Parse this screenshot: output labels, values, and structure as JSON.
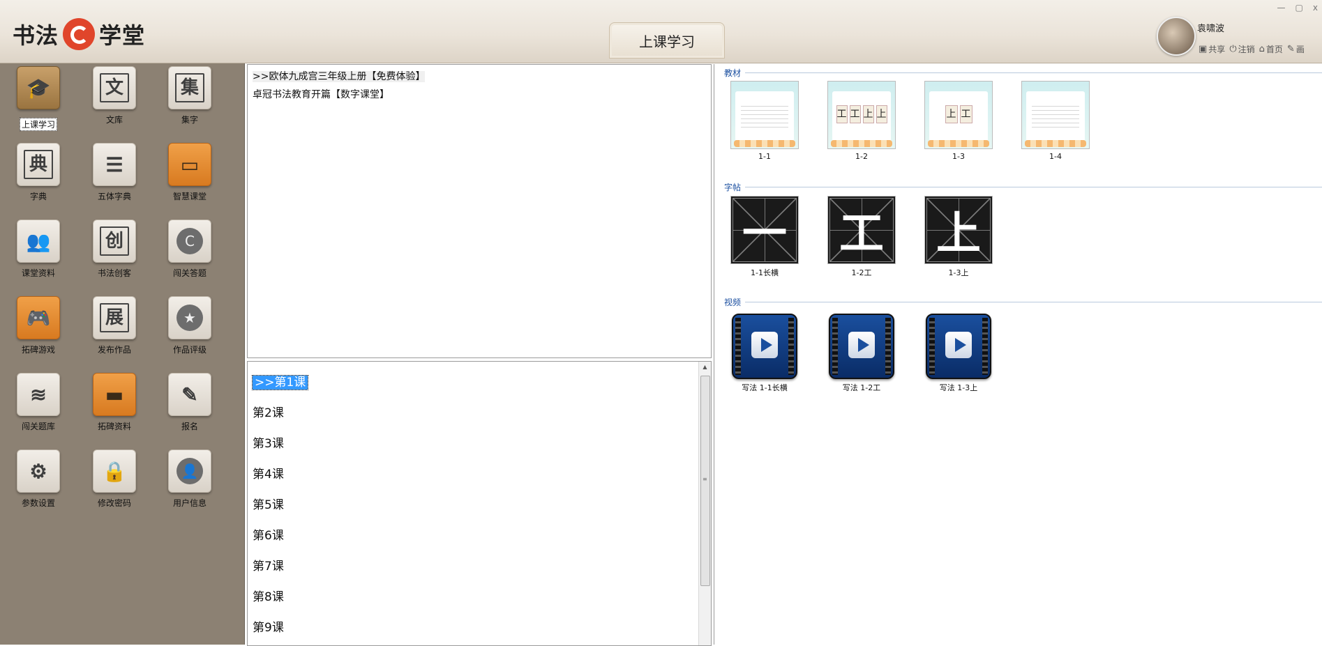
{
  "header": {
    "logo_left": "书法",
    "logo_right": "学堂",
    "title": "上课学习",
    "window_controls": [
      "—",
      "▢",
      "x"
    ],
    "user": {
      "name": "袁啸波",
      "links": [
        {
          "icon": "image-icon",
          "glyph": "▣",
          "label": "共享"
        },
        {
          "icon": "power-icon",
          "glyph": "⏻",
          "label": "注销"
        },
        {
          "icon": "home-icon",
          "glyph": "⌂",
          "label": "首页"
        },
        {
          "icon": "pencil-icon",
          "glyph": "✎",
          "label": "画"
        }
      ]
    }
  },
  "sidebar": {
    "items": [
      {
        "label": "上课学习",
        "icon": "graduation-cap-icon",
        "glyph": "🎓",
        "style": "selected"
      },
      {
        "label": "文库",
        "icon": "wen-char-icon",
        "glyph": "文",
        "style": "normal"
      },
      {
        "label": "集字",
        "icon": "ji-char-icon",
        "glyph": "集",
        "style": "normal"
      },
      {
        "label": "字典",
        "icon": "dian-char-icon",
        "glyph": "典",
        "style": "normal"
      },
      {
        "label": "五体字典",
        "icon": "list-book-icon",
        "glyph": "☰",
        "style": "normal"
      },
      {
        "label": "智慧课堂",
        "icon": "presentation-board-icon",
        "glyph": "▭",
        "style": "orange"
      },
      {
        "label": "课堂资料",
        "icon": "users-icon",
        "glyph": "👥",
        "style": "normal"
      },
      {
        "label": "书法创客",
        "icon": "chuang-char-icon",
        "glyph": "创",
        "style": "normal"
      },
      {
        "label": "闯关答题",
        "icon": "c-circle-icon",
        "glyph": "C",
        "style": "normal"
      },
      {
        "label": "拓碑游戏",
        "icon": "gamepad-icon",
        "glyph": "🎮",
        "style": "orange"
      },
      {
        "label": "发布作品",
        "icon": "zhan-char-icon",
        "glyph": "展",
        "style": "normal"
      },
      {
        "label": "作品评级",
        "icon": "star-circle-icon",
        "glyph": "★",
        "style": "normal"
      },
      {
        "label": "闯关题库",
        "icon": "layers-icon",
        "glyph": "≋",
        "style": "normal"
      },
      {
        "label": "拓碑资料",
        "icon": "book-icon",
        "glyph": "▬",
        "style": "orange"
      },
      {
        "label": "报名",
        "icon": "edit-icon",
        "glyph": "✎",
        "style": "normal"
      },
      {
        "label": "参数设置",
        "icon": "gears-icon",
        "glyph": "⚙",
        "style": "normal"
      },
      {
        "label": "修改密码",
        "icon": "lock-icon",
        "glyph": "🔒",
        "style": "normal"
      },
      {
        "label": "用户信息",
        "icon": "user-circle-icon",
        "glyph": "👤",
        "style": "normal"
      }
    ]
  },
  "courses": [
    ">>欧体九成宫三年级上册【免费体验】",
    "卓冠书法教育开篇【数字课堂】"
  ],
  "lessons": [
    ">>第1课",
    "第2课",
    "第3课",
    "第4课",
    "第5课",
    "第6课",
    "第7课",
    "第8课",
    "第9课"
  ],
  "resources": {
    "textbook": {
      "title": "教材",
      "items": [
        {
          "label": "1-1",
          "chars": ""
        },
        {
          "label": "1-2",
          "chars": "工工上上"
        },
        {
          "label": "1-3",
          "chars": "上工"
        },
        {
          "label": "1-4",
          "chars": ""
        }
      ]
    },
    "copybook": {
      "title": "字帖",
      "items": [
        {
          "label": "1-1长横",
          "char": "一"
        },
        {
          "label": "1-2工",
          "char": "工"
        },
        {
          "label": "1-3上",
          "char": "上"
        }
      ]
    },
    "video": {
      "title": "视频",
      "items": [
        {
          "label": "写法 1-1长横"
        },
        {
          "label": "写法 1-2工"
        },
        {
          "label": "写法 1-3上"
        }
      ]
    }
  }
}
